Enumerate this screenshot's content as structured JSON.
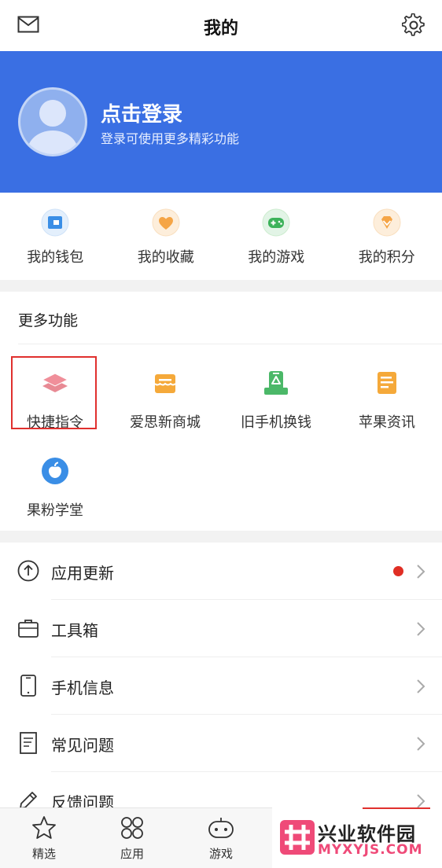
{
  "header": {
    "title": "我的"
  },
  "profile": {
    "login": "点击登录",
    "subtitle": "登录可使用更多精彩功能"
  },
  "quick": [
    {
      "label": "我的钱包",
      "icon": "wallet-icon",
      "color": "#3a8ee6"
    },
    {
      "label": "我的收藏",
      "icon": "heart-icon",
      "color": "#f5a546"
    },
    {
      "label": "我的游戏",
      "icon": "gamepad-icon",
      "color": "#3cb25a"
    },
    {
      "label": "我的积分",
      "icon": "points-icon",
      "color": "#f5a546"
    }
  ],
  "more": {
    "title": "更多功能",
    "items": [
      {
        "label": "快捷指令",
        "icon": "layers-icon"
      },
      {
        "label": "爱思新商城",
        "icon": "store-icon"
      },
      {
        "label": "旧手机换钱",
        "icon": "recycle-phone-icon"
      },
      {
        "label": "苹果资讯",
        "icon": "news-icon"
      },
      {
        "label": "果粉学堂",
        "icon": "apple-icon"
      }
    ]
  },
  "list": [
    {
      "label": "应用更新",
      "icon": "upload-arrow-icon",
      "badge": true
    },
    {
      "label": "工具箱",
      "icon": "toolbox-icon"
    },
    {
      "label": "手机信息",
      "icon": "phone-icon"
    },
    {
      "label": "常见问题",
      "icon": "document-icon"
    },
    {
      "label": "反馈问题",
      "icon": "pencil-icon"
    }
  ],
  "tabs": [
    {
      "label": "精选",
      "icon": "star-icon"
    },
    {
      "label": "应用",
      "icon": "apps-icon"
    },
    {
      "label": "游戏",
      "icon": "game-controller-icon"
    }
  ],
  "watermark": {
    "name": "兴业软件园",
    "domain": "MYXYJS.COM"
  },
  "colors": {
    "accent": "#3a6fe3",
    "badge": "#e02e24",
    "highlight": "#e0302e"
  }
}
